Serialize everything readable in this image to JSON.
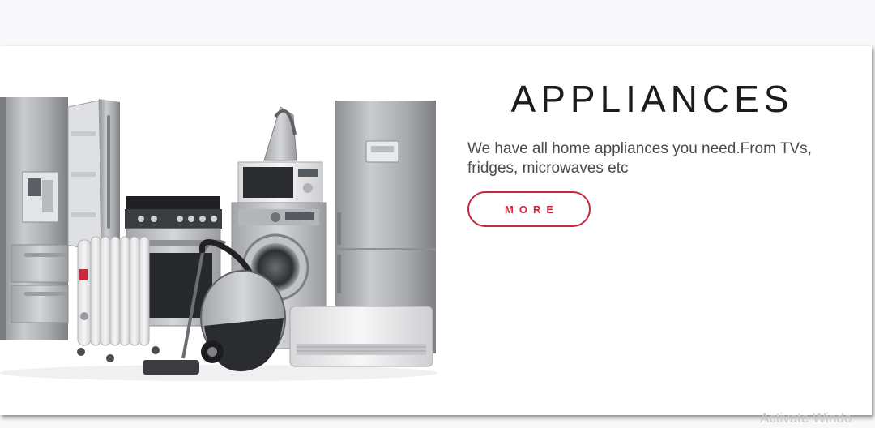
{
  "hero": {
    "title": "APPLIANCES",
    "description": "We have all home appliances you need.From TVs, fridges, microwaves etc",
    "more_label": "MORE",
    "image_alt": "home appliances group"
  },
  "watermark": {
    "text": "Activate Windo"
  },
  "colors": {
    "accent": "#c8283a",
    "title": "#1c1c1c",
    "text": "#4a4a4a",
    "page_bg": "#f8f8fa"
  }
}
